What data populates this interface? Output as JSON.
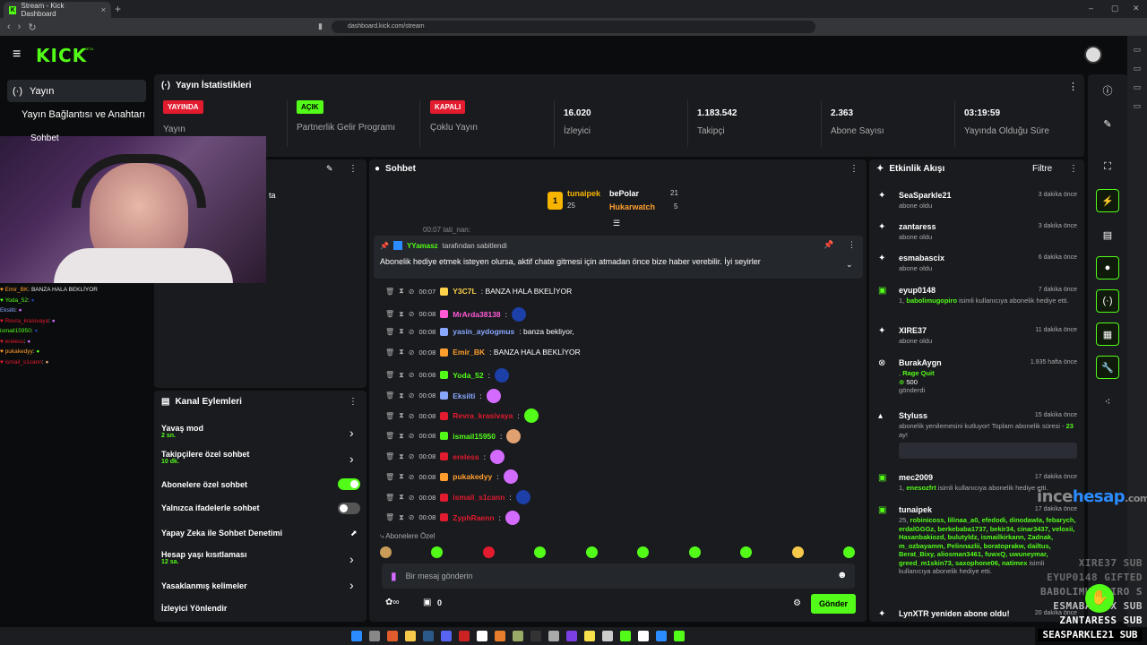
{
  "browser": {
    "tab_title": "Stream - Kick Dashboard",
    "url": "dashboard.kick.com/stream"
  },
  "app": {
    "logo": "KICK",
    "beta": "BETA"
  },
  "sidebar": {
    "items": [
      {
        "label": "Yayın"
      },
      {
        "label": "Yayın Bağlantısı ve Anahtarı"
      }
    ],
    "partial": "Sohbet",
    "partial2": "ta"
  },
  "stats": {
    "title": "Yayın İstatistikleri",
    "cards": [
      {
        "badge": "YAYINDA",
        "label": "Yayın",
        "badge_color": "#e21b2e"
      },
      {
        "badge": "AÇIK",
        "label": "Partnerlik Gelir Programı",
        "badge_color": "#53fc18"
      },
      {
        "badge": "KAPALI",
        "label": "Çoklu Yayın",
        "badge_color": "#e21b2e"
      },
      {
        "value": "16.020",
        "label": "İzleyici"
      },
      {
        "value": "1.183.542",
        "label": "Takipçi"
      },
      {
        "value": "2.363",
        "label": "Abone Sayısı"
      },
      {
        "value": "03:19:59",
        "label": "Yayında Olduğu Süre"
      }
    ]
  },
  "left_chat": [
    {
      "u": "Emir_BK",
      "m": ": BANZA HALA BEKLİYOR",
      "c": "#53fc18"
    },
    {
      "u": "Yoda_52",
      "m": ":",
      "c": "#53fc18"
    },
    {
      "u": "Eksilti",
      "m": ":",
      "c": "#8aa7ff"
    },
    {
      "u": "Revra_krasivaya",
      "m": ":",
      "c": "#e21b2e"
    },
    {
      "u": "ismail15950",
      "m": ":",
      "c": "#53fc18"
    },
    {
      "u": "ereless",
      "m": ":",
      "c": "#e21b2e"
    },
    {
      "u": "pukakedyy",
      "m": ":",
      "c": "#ff9e2c"
    },
    {
      "u": "ismail_s1cann",
      "m": ":",
      "c": "#e21b2e"
    }
  ],
  "channel_actions": {
    "title": "Kanal Eylemleri",
    "rows": [
      {
        "label": "Yavaş mod",
        "sub": "2 sn."
      },
      {
        "label": "Takipçilere özel sohbet",
        "sub": "10 dk."
      },
      {
        "label": "Abonelere özel sohbet",
        "toggle": true
      },
      {
        "label": "Yalnızca ifadelerle sohbet",
        "toggle": false
      },
      {
        "label": "Yapay Zeka ile Sohbet Denetimi"
      },
      {
        "label": "Hesap yaşı kısıtlaması",
        "sub": "12 sa."
      },
      {
        "label": "Yasaklanmış kelimeler"
      },
      {
        "label": "İzleyici Yönlendir"
      }
    ]
  },
  "chat": {
    "title": "Sohbet",
    "leaderboard": [
      {
        "name": "tunaipek",
        "count": "25"
      },
      {
        "name": "bePolar",
        "count": "21"
      },
      {
        "name": "Hukarwatch",
        "count": "5"
      }
    ],
    "pinned": {
      "by": "YYamasz",
      "by_suffix": "tarafından sabitlendi",
      "text": "Abonelik hediye etmek isteyen olursa, aktif chate gitmesi için atmadan önce bize haber verebilir. İyi seyirler"
    },
    "partial_top": "00:07 tati_nan:",
    "messages": [
      {
        "t": "00:07",
        "u": "Y3C7L",
        "m": ": BANZA HALA BKELİYOR",
        "c": "#ffd24a"
      },
      {
        "t": "00:08",
        "u": "MrArda38138",
        "m": ":",
        "c": "#ff5ad6"
      },
      {
        "t": "00:08",
        "u": "yasin_aydogmus",
        "m": ": banza bekliyor,",
        "c": "#8aa7ff"
      },
      {
        "t": "00:08",
        "u": "Emir_BK",
        "m": ": BANZA HALA BEKLİYOR",
        "c": "#ff9e2c"
      },
      {
        "t": "00:08",
        "u": "Yoda_52",
        "m": ":",
        "c": "#53fc18"
      },
      {
        "t": "00:08",
        "u": "Eksilti",
        "m": ":",
        "c": "#8aa7ff"
      },
      {
        "t": "00:08",
        "u": "Revra_krasivaya",
        "m": ":",
        "c": "#e21b2e"
      },
      {
        "t": "00:08",
        "u": "ismail15950",
        "m": ":",
        "c": "#53fc18"
      },
      {
        "t": "00:08",
        "u": "ereless",
        "m": ":",
        "c": "#e21b2e"
      },
      {
        "t": "00:08",
        "u": "pukakedyy",
        "m": ":",
        "c": "#ff9e2c"
      },
      {
        "t": "00:08",
        "u": "ismail_s1cann",
        "m": ":",
        "c": "#e21b2e"
      },
      {
        "t": "00:08",
        "u": "ZyphRaenn",
        "m": ":",
        "c": "#e21b2e"
      }
    ],
    "sub_only": "Abonelere Özel",
    "input_placeholder": "Bir mesaj gönderin",
    "points": "0",
    "send": "Gönder"
  },
  "activity": {
    "title": "Etkinlik Akışı",
    "filter": "Filtre",
    "items": [
      {
        "n": "SeaSparkle21",
        "w": "3 dakika önce",
        "d": "abone oldu"
      },
      {
        "n": "zantaress",
        "w": "3 dakika önce",
        "d": "abone oldu"
      },
      {
        "n": "esmabascix",
        "w": "6 dakika önce",
        "d": "abone oldu"
      },
      {
        "n": "eyup0148",
        "w": "7 dakika önce",
        "d1": "1,",
        "g": "babolimugopiro",
        "d2": "isimli kullanıcıya abonelik hediye etti."
      },
      {
        "n": "XIRE37",
        "w": "11 dakika önce",
        "d": "abone oldu"
      },
      {
        "n": "BurakAygn",
        "w": "1.935 hafta önce",
        "g": "Rage Quit",
        "d1": ",",
        "d2": "500",
        "d3": "gönderdi"
      },
      {
        "n": "Styluss",
        "w": "15 dakika önce",
        "d": "abonelik yenilemesini kutluyor! Toplam abonelik süresi -",
        "g": "23",
        "d4": "ay!"
      },
      {
        "n": "mec2009",
        "w": "17 dakika önce",
        "d1": "1,",
        "g": "enesozfrt",
        "d2": "isimli kullanıcıya abonelik hediye etti."
      },
      {
        "n": "tunaipek",
        "w": "17 dakika önce",
        "d1": "25,",
        "g": "robinicoss, lilinaa_a0, efedodi, dinodawla, febarych, erdalGGGz, berkebaba1737, bekir34, cinar3437, veloxii, Hasanbakiozd, bulutyldz, ismailkirkann, Zadnak, m_ozbayamm, Pelinnazlii, boratoprakw, dailtus, Berat_Bixy, aliosman3461, fuwxQ, uwuneymar, greed_m1skin73, saxophone06, natimex",
        "d2": "isimli kullanıcıya abonelik hediye etti."
      },
      {
        "n": "LynXTR yeniden abone oldu!",
        "w": "20 dakika önce"
      }
    ]
  },
  "overlay": {
    "watermark_a": "ince",
    "watermark_b": "hesap",
    "watermark_c": ".com",
    "subs": [
      "XIRE37 SUB",
      "EYUP0148 GIFTED",
      "BABOLIMUGOPIRO S",
      "ESMABASCIX SUB",
      "ZANTARESS SUB"
    ],
    "last": "SEASPARKLE21 SUB"
  },
  "colors": {
    "accent": "#53fc18",
    "danger": "#e21b2e",
    "panel": "#191b1f",
    "bg": "#0b0c0d"
  }
}
